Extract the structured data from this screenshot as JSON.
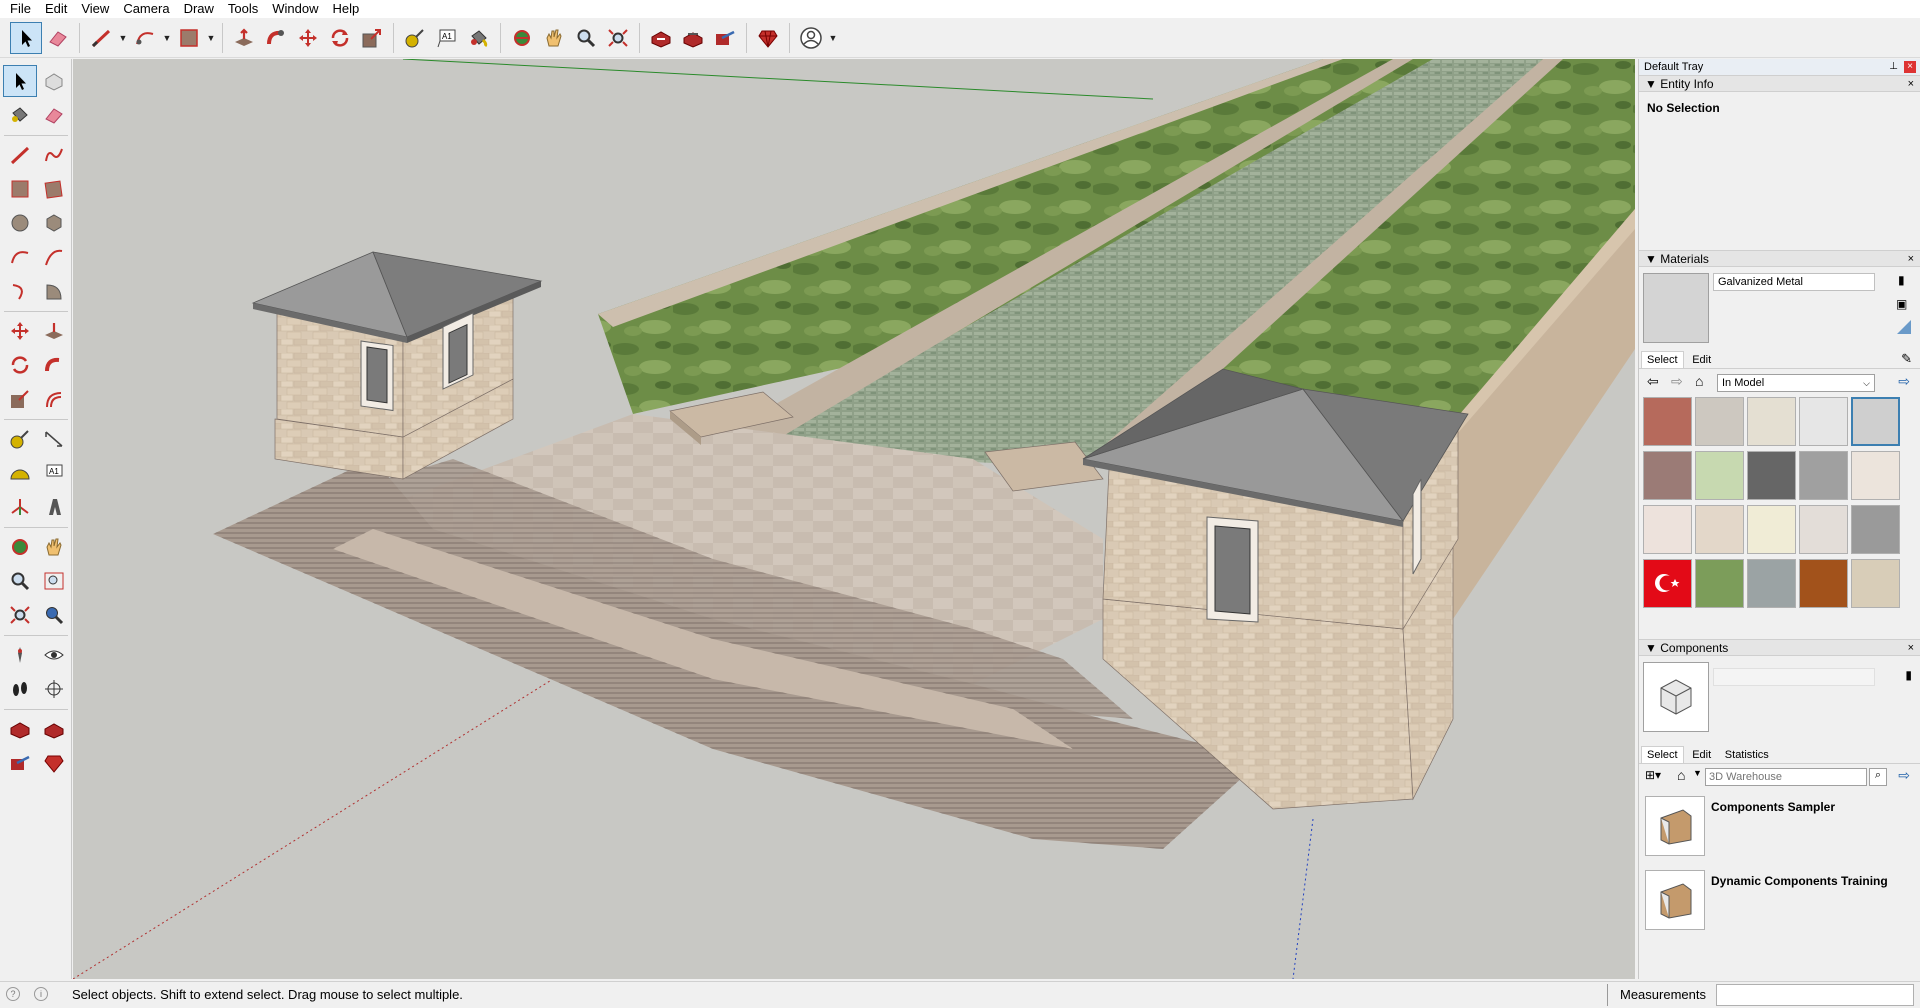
{
  "menu": [
    "File",
    "Edit",
    "View",
    "Camera",
    "Draw",
    "Tools",
    "Window",
    "Help"
  ],
  "tray": {
    "title": "Default Tray"
  },
  "entity_info": {
    "title": "Entity Info",
    "selection": "No Selection"
  },
  "materials": {
    "title": "Materials",
    "name_value": "Galvanized Metal",
    "tabs": [
      "Select",
      "Edit"
    ],
    "library": "In Model",
    "swatches": [
      "#b66a5c",
      "#cdc8c0",
      "#e4dfd2",
      "#e6e6e6",
      "#cfcfcf",
      "#9b7b76",
      "#c7d9b0",
      "#666666",
      "#a0a0a0",
      "#ece4dc",
      "#ede2dc",
      "#e3d7c9",
      "#f0ecd6",
      "#e3ddd8",
      "#9a9a9a",
      "#e30a17",
      "#7c9d5a",
      "#9ba3a4",
      "#a2521b",
      "#d8cdb8"
    ]
  },
  "components": {
    "title": "Components",
    "tabs": [
      "Select",
      "Edit",
      "Statistics"
    ],
    "search_placeholder": "3D Warehouse",
    "items": [
      "Components Sampler",
      "Dynamic Components Training"
    ]
  },
  "status": {
    "message": "Select objects. Shift to extend select. Drag mouse to select multiple.",
    "measurements_label": "Measurements",
    "measurements_value": ""
  }
}
